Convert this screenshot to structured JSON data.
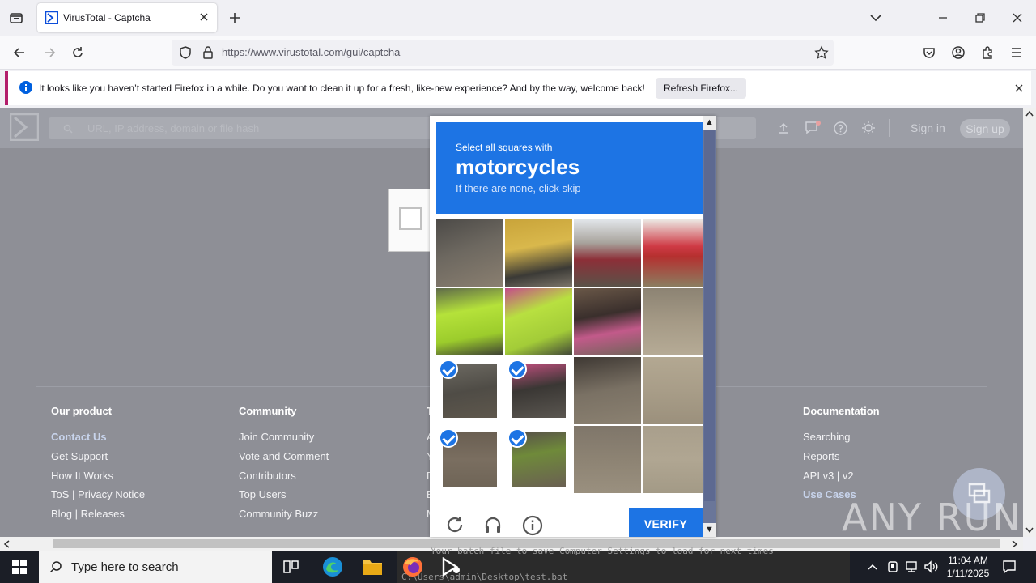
{
  "browser": {
    "tab_title": "VirusTotal - Captcha",
    "url": "https://www.virustotal.com/gui/captcha",
    "notification": "It looks like you haven’t started Firefox in a while. Do you want to clean it up for a fresh, like-new experience? And by the way, welcome back!",
    "refresh_button": "Refresh Firefox..."
  },
  "vt": {
    "search_placeholder": "URL, IP address, domain or file hash",
    "sign_in": "Sign in",
    "sign_up": "Sign up"
  },
  "footer": {
    "col1": {
      "heading": "Our product",
      "links": [
        "Contact Us",
        "Get Support",
        "How It Works",
        "ToS | Privacy Notice",
        "Blog | Releases"
      ]
    },
    "col2": {
      "heading": "Community",
      "links": [
        "Join Community",
        "Vote and Comment",
        "Contributors",
        "Top Users",
        "Community Buzz"
      ]
    },
    "col3": {
      "heading": "T",
      "links": [
        "A",
        "Y",
        "D",
        "E",
        "M"
      ]
    },
    "col4": {
      "heading": "Documentation",
      "links": [
        "Searching",
        "Reports",
        "API v3 | v2",
        "Use Cases"
      ]
    }
  },
  "captcha": {
    "instruction": "Select all squares with",
    "target": "motorcycles",
    "hint": "If there are none, click skip",
    "verify": "VERIFY",
    "selected_tiles": [
      8,
      9,
      12,
      13
    ]
  },
  "watermark": "ANY RUN",
  "taskbar": {
    "search_text": "Type here to search",
    "console_line1": "Your batch file to save Computer Settings to load for next times",
    "console_line2": "C:\\Users\\admin\\Desktop\\test.bat",
    "time": "11:04 AM",
    "date": "1/11/2025"
  },
  "colors": {
    "accent": "#1d74e4",
    "page_overlay": "#8e8f96"
  }
}
